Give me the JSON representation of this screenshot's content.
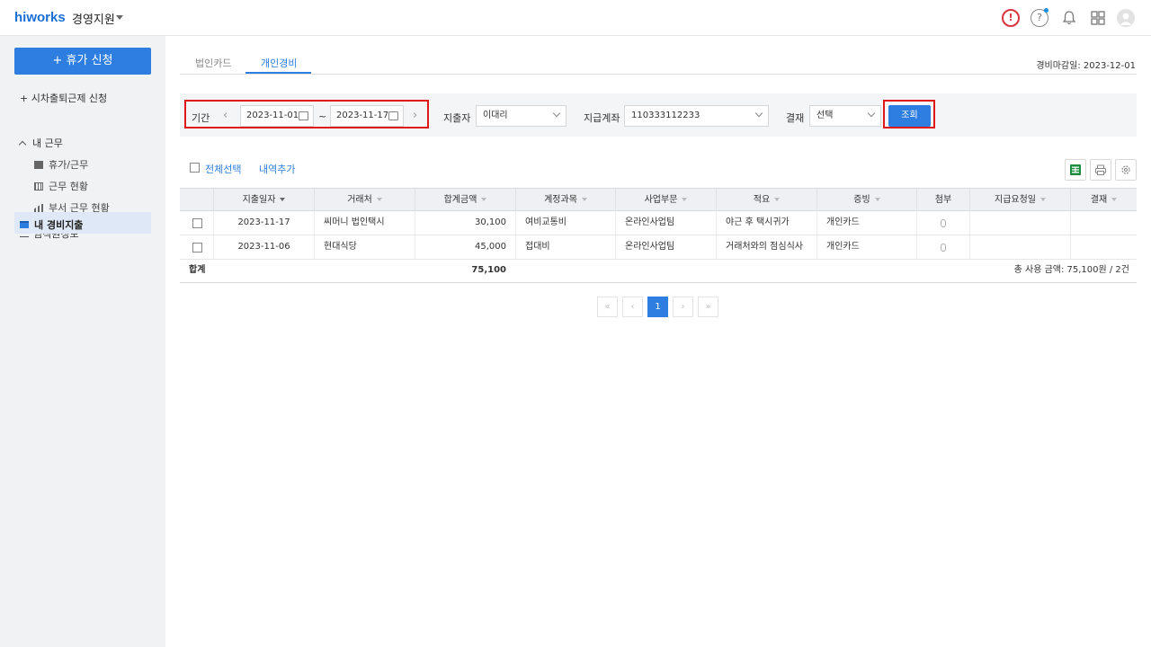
{
  "header": {
    "logo": "hiworks",
    "app_name": "경영지원",
    "icons": [
      "alert-icon",
      "help-icon",
      "bell-icon",
      "apps-grid-icon",
      "avatar"
    ],
    "alert_glyph": "!",
    "help_glyph": "?"
  },
  "sidebar": {
    "primary_button": "+ 휴가 신청",
    "flex_request": "+ 시차출퇴근제 신청",
    "my_work_section": "내 근무",
    "my_work_items": [
      "휴가/근무",
      "근무 현황",
      "부서 근무 현황"
    ],
    "employee_info": "임직원정보",
    "my_expense": "내 경비지출"
  },
  "tabs": [
    {
      "label": "법인카드",
      "active": false
    },
    {
      "label": "개인경비",
      "active": true
    }
  ],
  "deadline": "경비마감일: 2023-12-01",
  "filters": {
    "period_label": "기간",
    "start_date": "2023-11-01",
    "separator": "~",
    "end_date": "2023-11-17",
    "spender_label": "지출자",
    "spender_value": "이대리",
    "account_label": "지급계좌",
    "account_value": "110333112233",
    "approval_label": "결재",
    "approval_value": "선택",
    "search_button": "조회"
  },
  "toolbar": {
    "select_all": "전체선택",
    "add_item": "내역추가"
  },
  "table": {
    "columns": [
      "지출일자",
      "거래처",
      "합계금액",
      "계정과목",
      "사업부문",
      "적요",
      "증빙",
      "첨부",
      "지급요청일",
      "결재"
    ],
    "rows": [
      {
        "date": "2023-11-17",
        "vendor": "씨머니 법인택시",
        "amount": "30,100",
        "account": "여비교통비",
        "division": "온라인사업팀",
        "memo": "야근 후 택시귀가",
        "proof": "개인카드",
        "request_date": "",
        "approval": ""
      },
      {
        "date": "2023-11-06",
        "vendor": "현대식당",
        "amount": "45,000",
        "account": "접대비",
        "division": "온라인사업팀",
        "memo": "거래처와의 점심식사",
        "proof": "개인카드",
        "request_date": "",
        "approval": ""
      }
    ],
    "total_label": "합계",
    "total_amount": "75,100",
    "total_summary": "총 사용 금액: 75,100원 / 2건"
  },
  "pagination": {
    "first": "«",
    "prev": "‹",
    "current": "1",
    "next": "›",
    "last": "»"
  },
  "colors": {
    "accent": "#2d7ee0",
    "highlight_box": "#e11818",
    "sidebar_bg": "#f1f2f4"
  }
}
